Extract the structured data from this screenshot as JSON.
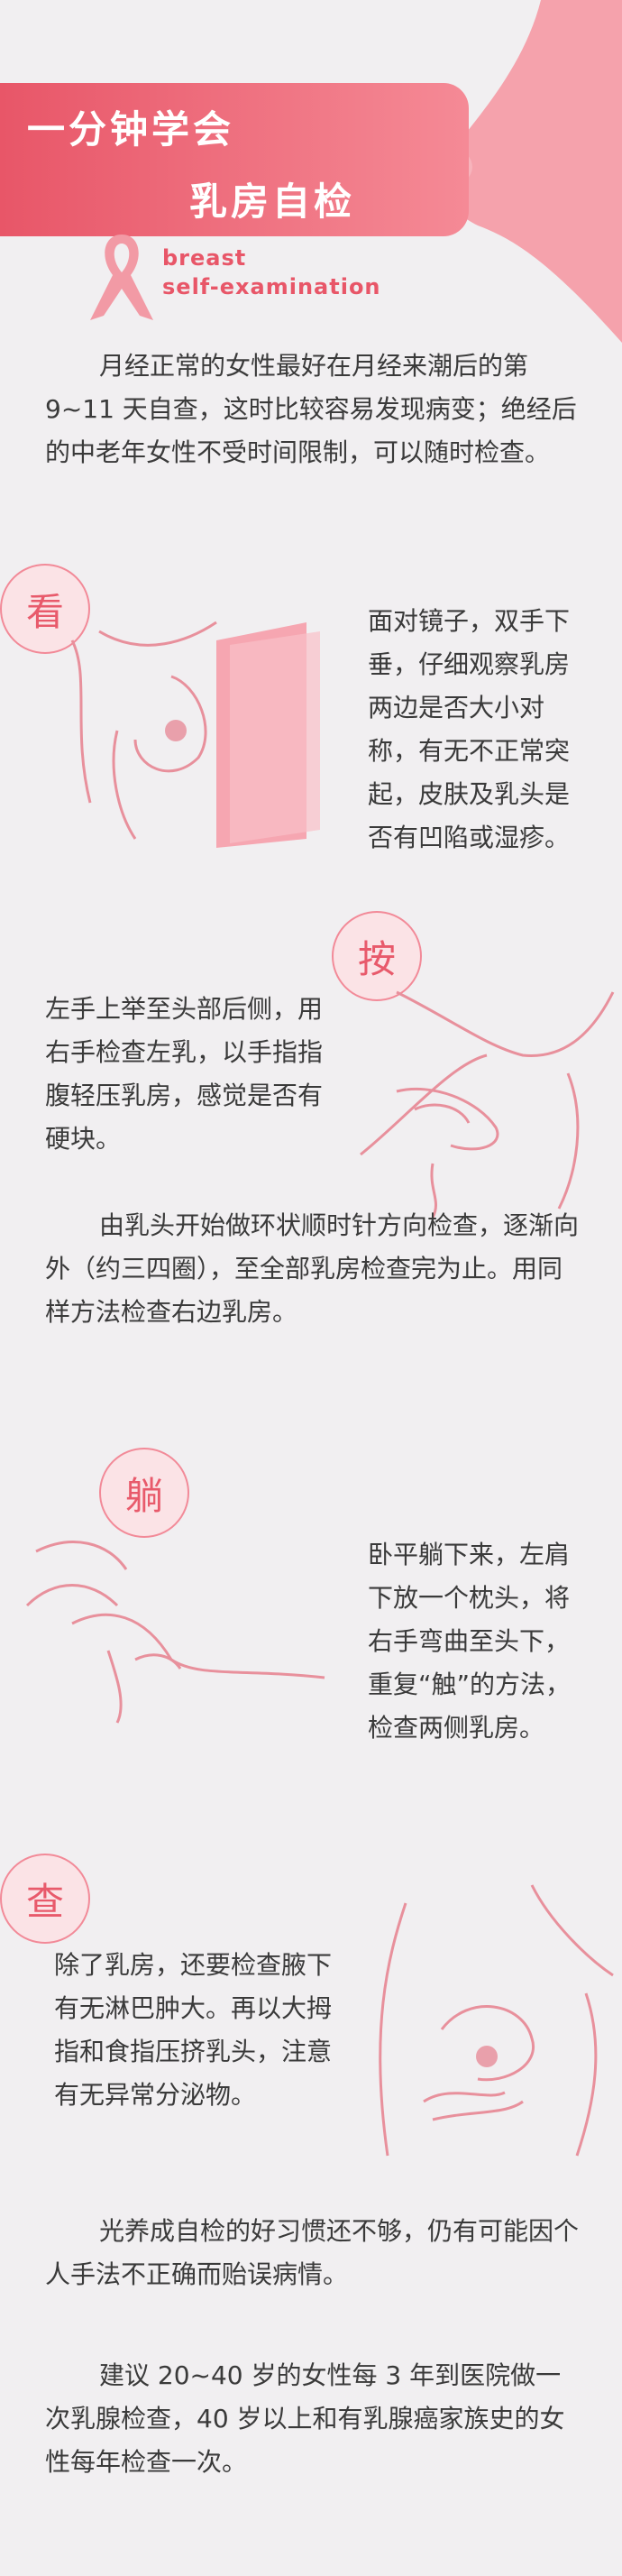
{
  "header": {
    "title_line1": "一分钟学会",
    "title_line2": "乳房自检",
    "english_line1": "breast",
    "english_line2": "self-examination"
  },
  "intro": "月经正常的女性最好在月经来潮后的第 9~11 天自查，这时比较容易发现病变；绝经后的中老年女性不受时间限制，可以随时检查。",
  "steps": [
    {
      "badge": "看",
      "text": "面对镜子，双手下垂，仔细观察乳房两边是否大小对称，有无不正常突起，皮肤及乳头是否有凹陷或湿疹。"
    },
    {
      "badge": "按",
      "text": "左手上举至头部后侧，用右手检查左乳，以手指指腹轻压乳房，感觉是否有硬块。",
      "extra": "由乳头开始做环状顺时针方向检查，逐渐向外（约三四圈），至全部乳房检查完为止。用同样方法检查右边乳房。"
    },
    {
      "badge": "躺",
      "text": "卧平躺下来，左肩下放一个枕头，将右手弯曲至头下，重复“触”的方法，检查两侧乳房。"
    },
    {
      "badge": "查",
      "text": "除了乳房，还要检查腋下有无淋巴肿大。再以大拇指和食指压挤乳头，注意有无异常分泌物。"
    }
  ],
  "outro1": "光养成自检的好习惯还不够，仍有可能因个人手法不正确而贻误病情。",
  "outro2": "建议 20~40 岁的女性每 3 年到医院做一次乳腺检查，40 岁以上和有乳腺癌家族史的女性每年检查一次。",
  "colors": {
    "accent": "#e85668",
    "line": "#e8909c",
    "background": "#f1eff1"
  }
}
